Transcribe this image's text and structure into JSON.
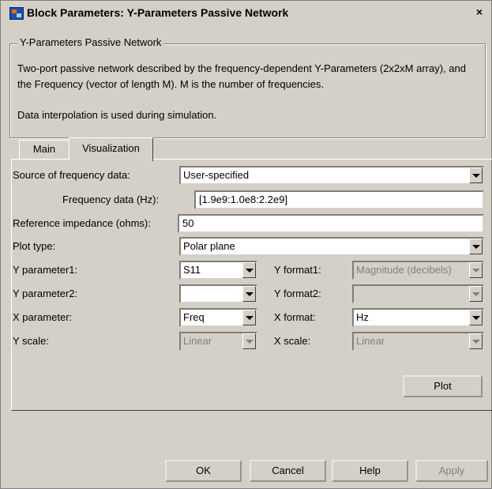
{
  "window": {
    "title": "Block Parameters: Y-Parameters Passive Network",
    "close": "×"
  },
  "group": {
    "title": "Y-Parameters Passive Network",
    "description": "Two-port passive network described by the frequency-dependent Y-Parameters (2x2xM array), and the Frequency (vector of length M).  M is the number of frequencies.",
    "interp_note": "Data interpolation is used during simulation."
  },
  "tabs": [
    {
      "label": "Main",
      "active": false
    },
    {
      "label": "Visualization",
      "active": true
    }
  ],
  "form": {
    "source_label": "Source of frequency data:",
    "source_value": "User-specified",
    "freq_label": "Frequency data (Hz):",
    "freq_value": "[1.9e9:1.0e8:2.2e9]",
    "ref_label": "Reference impedance (ohms):",
    "ref_value": "50",
    "plot_type_label": "Plot type:",
    "plot_type_value": "Polar plane",
    "y1_label": "Y parameter1:",
    "y1_value": "S11",
    "yf1_label": "Y format1:",
    "yf1_value": "Magnitude (decibels)",
    "y2_label": "Y parameter2:",
    "y2_value": "",
    "yf2_label": "Y format2:",
    "yf2_value": "",
    "xp_label": "X parameter:",
    "xp_value": "Freq",
    "xf_label": "X format:",
    "xf_value": "Hz",
    "ys_label": "Y scale:",
    "ys_value": "Linear",
    "xs_label": "X scale:",
    "xs_value": "Linear",
    "plot_button": "Plot"
  },
  "buttons": {
    "ok": "OK",
    "cancel": "Cancel",
    "help": "Help",
    "apply": "Apply"
  }
}
